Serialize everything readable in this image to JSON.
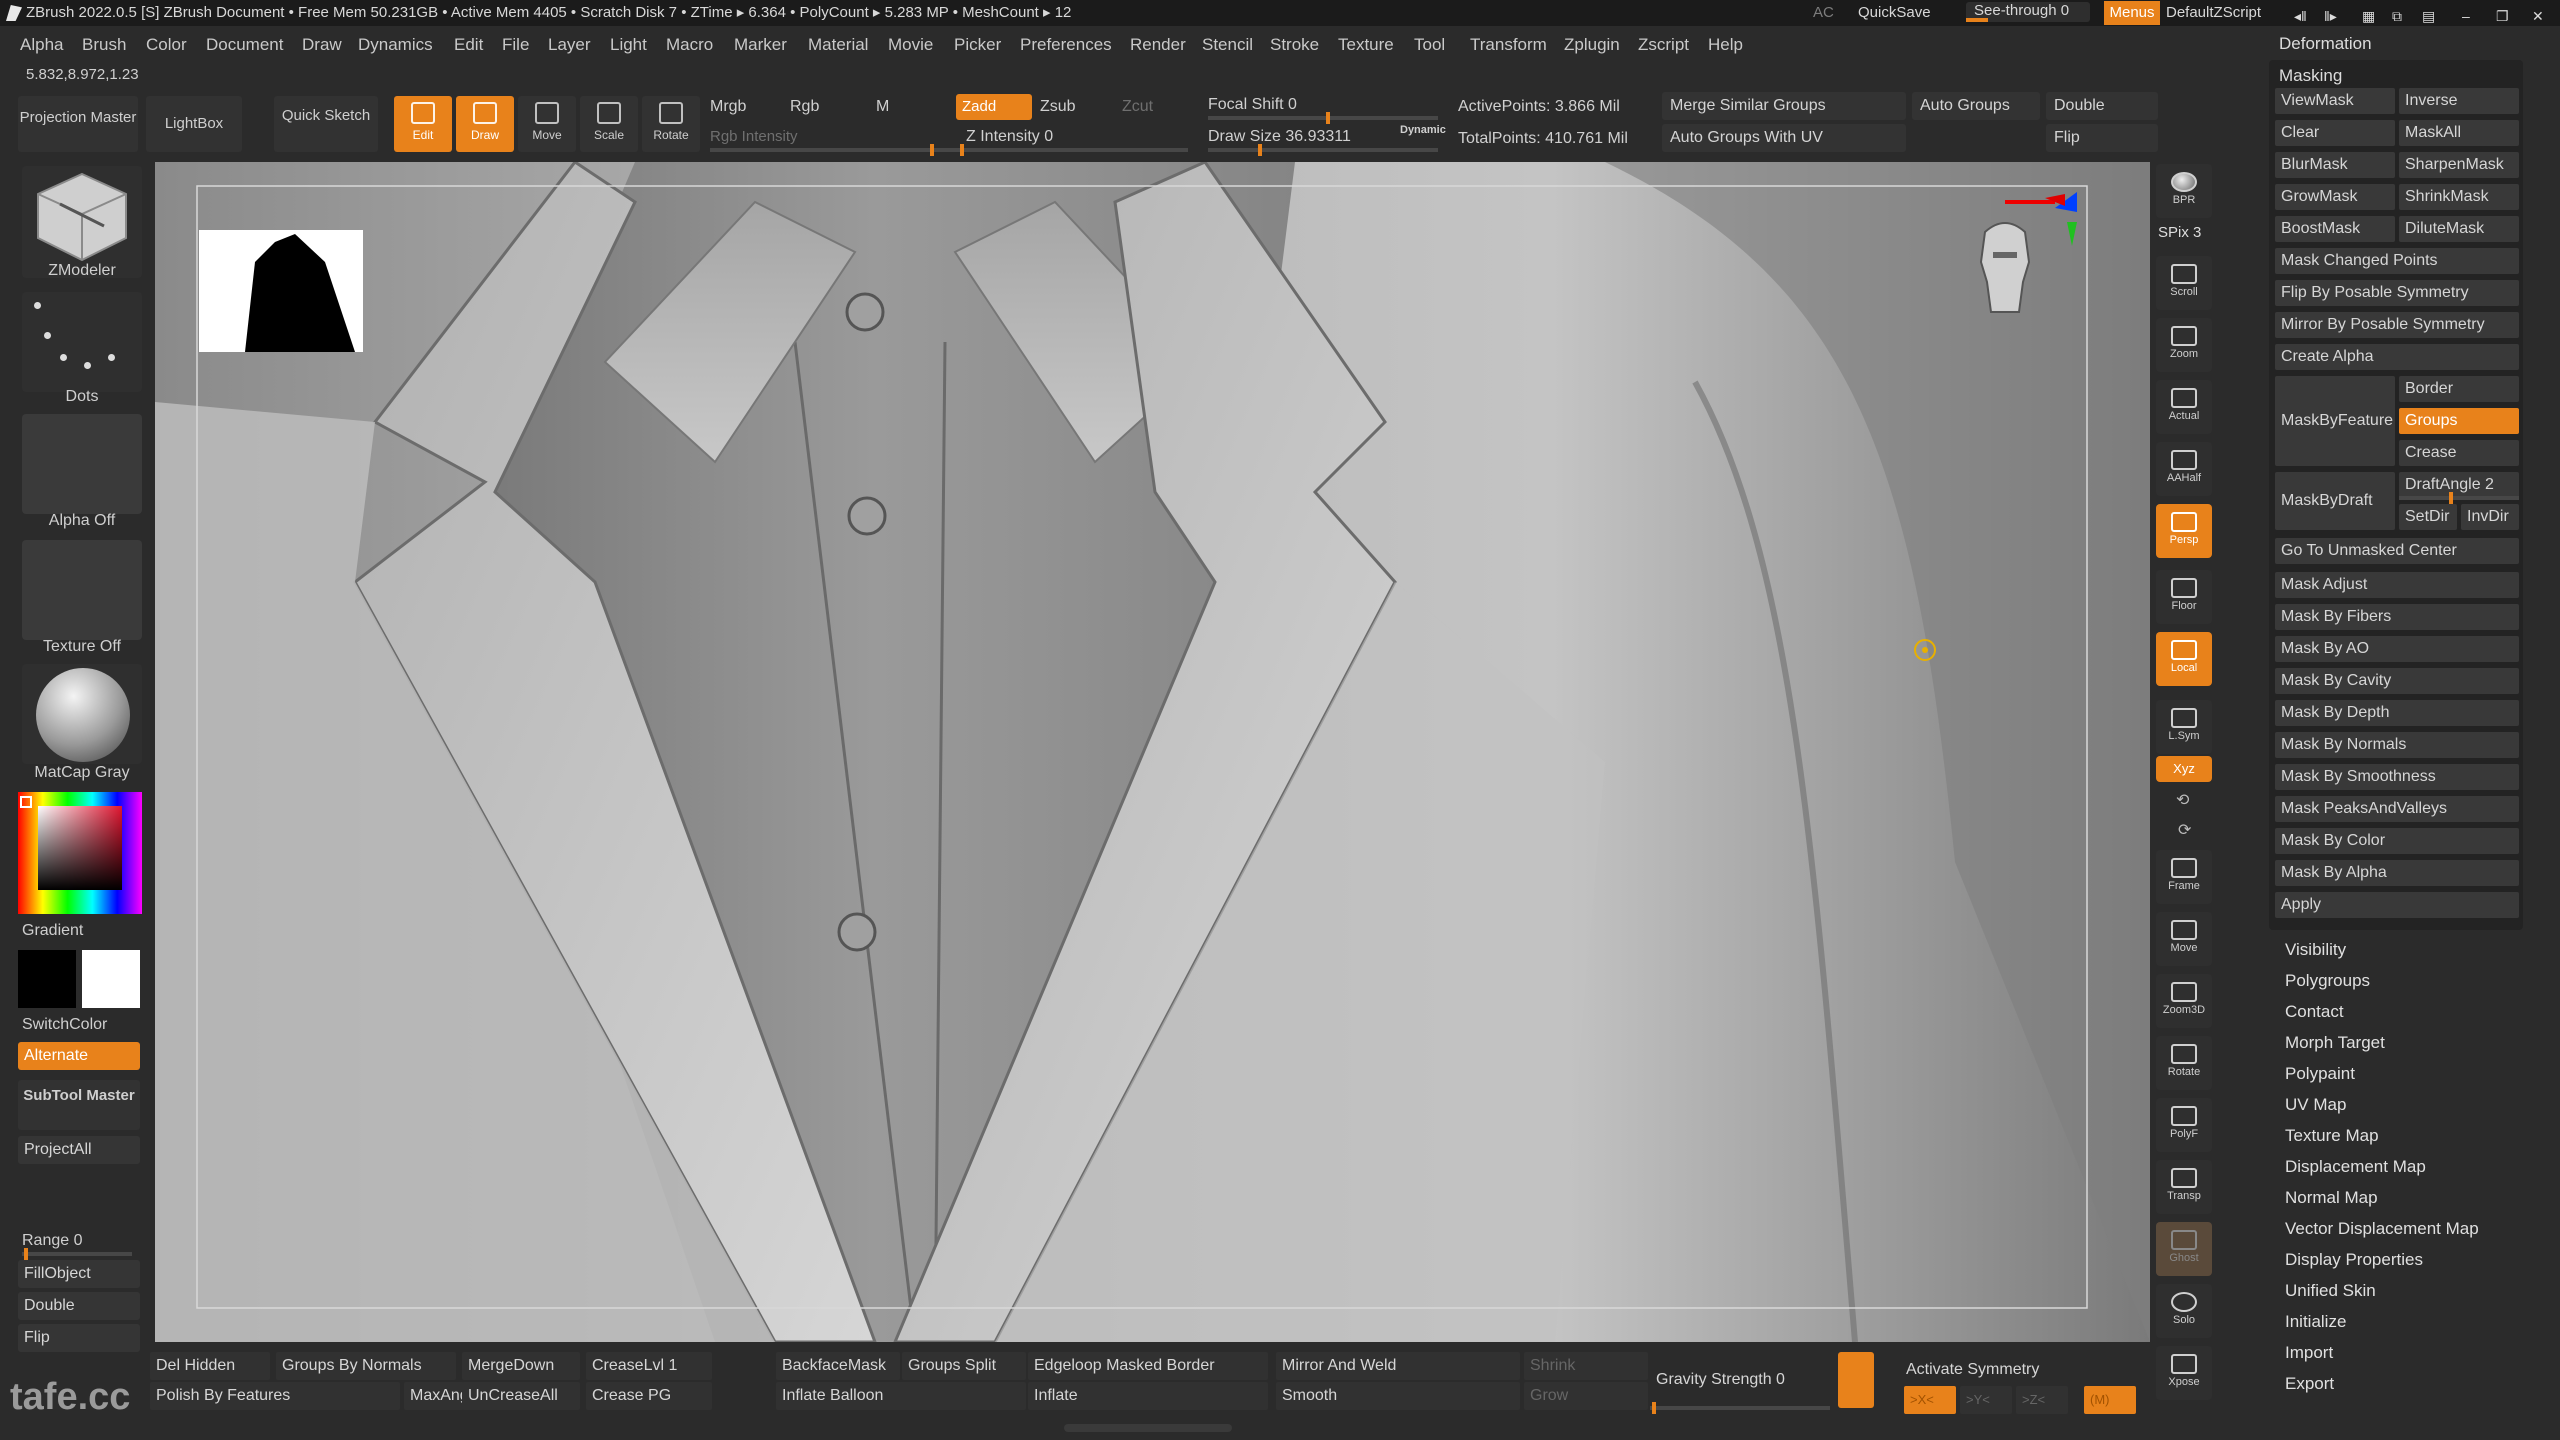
{
  "titlebar": {
    "title": "ZBrush 2022.0.5 [S]  ZBrush Document    • Free Mem 50.231GB • Active Mem 4405 • Scratch Disk 7 • ZTime ▸ 6.364 • PolyCount ▸ 5.283 MP  • MeshCount ▸ 12",
    "ac": "AC",
    "quicksave": "QuickSave",
    "see_through": "See-through  0",
    "see_through_value": 0,
    "menus": "Menus",
    "default_zscript": "DefaultZScript"
  },
  "menubar": [
    "Alpha",
    "Brush",
    "Color",
    "Document",
    "Draw",
    "Dynamics",
    "Edit",
    "File",
    "Layer",
    "Light",
    "Macro",
    "Marker",
    "Material",
    "Movie",
    "Picker",
    "Preferences",
    "Render",
    "Stencil",
    "Stroke",
    "Texture",
    "Tool",
    "Transform",
    "Zplugin",
    "Zscript",
    "Help"
  ],
  "coords": "5.832,8.972,1.23",
  "toolbar": {
    "projection_master": "Projection Master",
    "lightbox": "LightBox",
    "quick_sketch": "Quick Sketch",
    "edit": "Edit",
    "draw": "Draw",
    "move": "Move",
    "scale": "Scale",
    "rotate": "Rotate",
    "mrgb": "Mrgb",
    "rgb": "Rgb",
    "m": "M",
    "rgb_intensity": "Rgb Intensity",
    "zadd": "Zadd",
    "zsub": "Zsub",
    "zcut": "Zcut",
    "z_intensity": "Z Intensity 0",
    "focal_shift": "Focal Shift 0",
    "draw_size": "Draw Size 36.93311",
    "dynamic": "Dynamic",
    "active_points": "ActivePoints: 3.866 Mil",
    "total_points": "TotalPoints: 410.761 Mil",
    "merge_similar_groups": "Merge Similar Groups",
    "auto_groups": "Auto Groups",
    "double": "Double",
    "auto_groups_uv": "Auto Groups With UV",
    "flip": "Flip"
  },
  "leftshelf": {
    "zmodeler": "ZModeler",
    "dots": "Dots",
    "alpha_off": "Alpha Off",
    "texture_off": "Texture Off",
    "matcap": "MatCap Gray",
    "gradient": "Gradient",
    "switchcolor": "SwitchColor",
    "alternate": "Alternate",
    "subtool_master": "SubTool Master",
    "projectall": "ProjectAll",
    "range": "Range 0",
    "fillobject": "FillObject",
    "double": "Double",
    "flip": "Flip",
    "watermark": "tafe.cc"
  },
  "righticons": [
    "BPR",
    "SPix 3",
    "Scroll",
    "Zoom",
    "Actual",
    "AAHalf",
    "Persp",
    "Floor",
    "Local",
    "L.Sym",
    "Xyz",
    "Frame",
    "Move",
    "Zoom3D",
    "Rotate",
    "PolyF",
    "Transp",
    "Ghost",
    "Solo",
    "Xpose"
  ],
  "rightpanel": {
    "deformation": "Deformation",
    "masking": "Masking",
    "viewmask": "ViewMask",
    "inverse": "Inverse",
    "clear": "Clear",
    "maskall": "MaskAll",
    "blurmask": "BlurMask",
    "sharpenmask": "SharpenMask",
    "growmask": "GrowMask",
    "shrinkmask": "ShrinkMask",
    "boostmask": "BoostMask",
    "dilutemask": "DiluteMask",
    "mask_changed_points": "Mask Changed Points",
    "flip_by_posable": "Flip By Posable Symmetry",
    "mirror_by_posable": "Mirror By Posable Symmetry",
    "create_alpha": "Create Alpha",
    "border": "Border",
    "maskbyfeature": "MaskByFeature",
    "groups": "Groups",
    "crease": "Crease",
    "maskbydraft": "MaskByDraft",
    "draftangle": "DraftAngle 2",
    "setdir": "SetDir",
    "invdir": "InvDir",
    "go_to_unmasked": "Go To Unmasked Center",
    "mask_items": [
      "Mask Adjust",
      "Mask By Fibers",
      "Mask By AO",
      "Mask By Cavity",
      "Mask By Depth",
      "Mask By Normals",
      "Mask By Smoothness",
      "Mask PeaksAndValleys",
      "Mask By Color",
      "Mask By Alpha",
      "Apply"
    ],
    "sections": [
      "Visibility",
      "Polygroups",
      "Contact",
      "Morph Target",
      "Polypaint",
      "UV Map",
      "Texture Map",
      "Displacement Map",
      "Normal Map",
      "Vector Displacement Map",
      "Display Properties",
      "Unified Skin",
      "Initialize",
      "Import",
      "Export"
    ]
  },
  "bottombar": {
    "del_hidden": "Del Hidden",
    "groups_by_normals": "Groups By Normals",
    "mergedown": "MergeDown",
    "creaselvl": "CreaseLvl 1",
    "polish_by_features": "Polish By Features",
    "maxang": "MaxAng",
    "uncreaseall": "UnCreaseAll",
    "crease_pg": "Crease PG",
    "backfacemask": "BackfaceMask",
    "groups_split": "Groups Split",
    "edgeloop_masked_border": "Edgeloop Masked Border",
    "mirror_and_weld": "Mirror And Weld",
    "shrink": "Shrink",
    "inflate_balloon": "Inflate Balloon",
    "inflate": "Inflate",
    "smooth": "Smooth",
    "grow": "Grow",
    "gravity_strength": "Gravity Strength 0",
    "activate_symmetry": "Activate Symmetry",
    "sym_x": ">X<",
    "sym_y": ">Y<",
    "sym_z": ">Z<",
    "sym_m": "(M)"
  },
  "colors": {
    "accent": "#e8821b",
    "panel": "#2b2b2b",
    "viewport": "#8f8f8f"
  }
}
